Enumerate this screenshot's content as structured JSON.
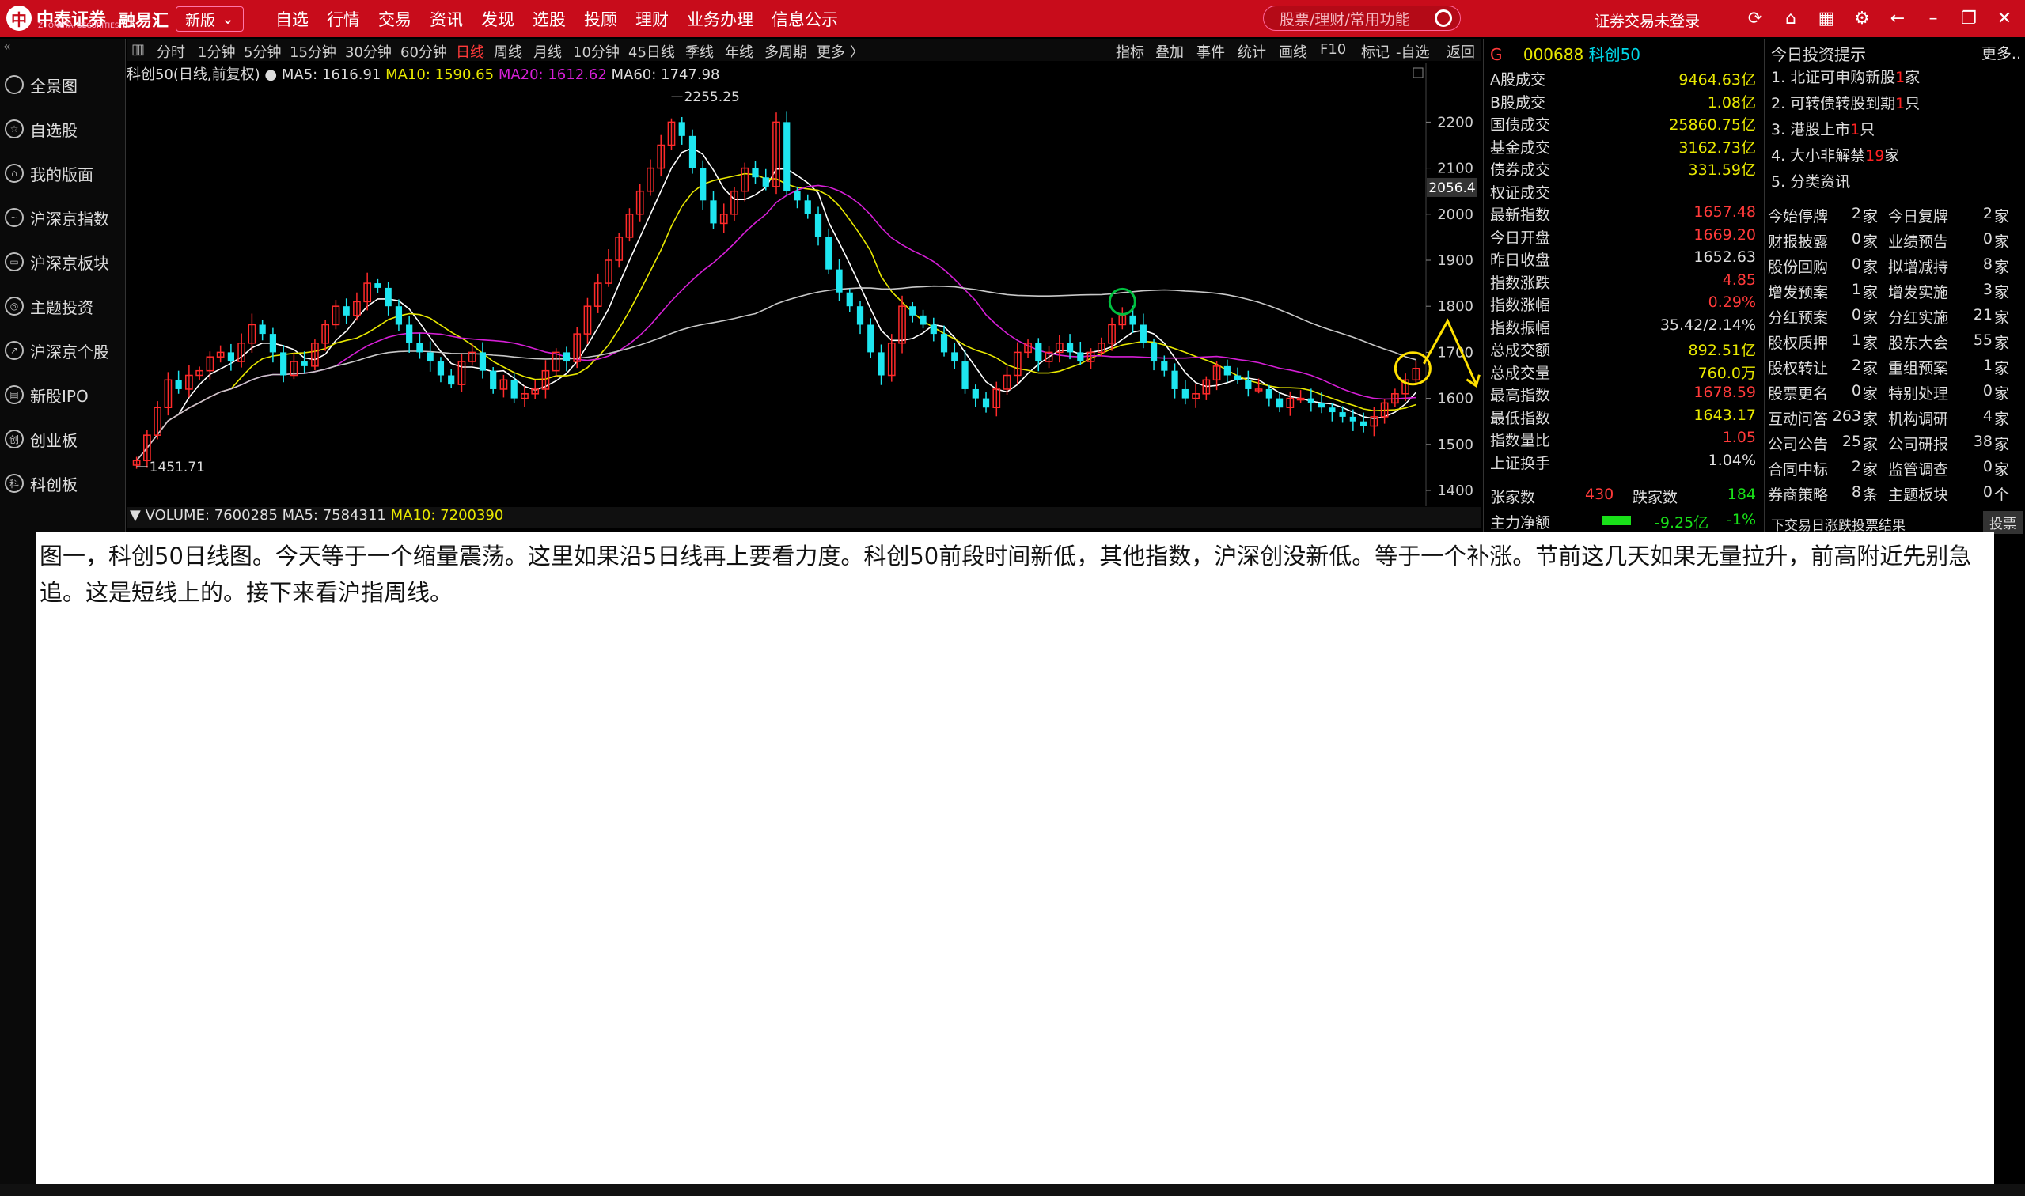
{
  "titlebar": {
    "logo_text": "中泰证券",
    "logo_en": "ZHONGTAI SECURITIES",
    "brand2": "融易汇",
    "version_select": "新版",
    "menu": [
      "自选",
      "行情",
      "交易",
      "资讯",
      "发现",
      "选股",
      "投顾",
      "理财",
      "业务办理",
      "信息公示"
    ],
    "search_placeholder": "股票/理财/常用功能",
    "login_status": "证券交易未登录"
  },
  "toolbar": {
    "periods": [
      "分时",
      "1分钟",
      "5分钟",
      "15分钟",
      "30分钟",
      "60分钟",
      "日线",
      "周线",
      "月线",
      "10分钟",
      "45日线",
      "季线",
      "年线",
      "多周期",
      "更多 〉"
    ],
    "active_period": "日线",
    "tools": [
      "指标",
      "叠加",
      "事件",
      "统计",
      "画线",
      "F10",
      "标记",
      "-自选",
      "返回"
    ]
  },
  "leftnav": {
    "items": [
      "全景图",
      "自选股",
      "我的版面",
      "沪深京指数",
      "沪深京板块",
      "主题投资",
      "沪深京个股",
      "新股IPO",
      "创业板",
      "科创板"
    ]
  },
  "chart": {
    "legend": {
      "name": "科创50(日线,前复权)",
      "ma5": "MA5: 1616.91",
      "ma10": "MA10: 1590.65",
      "ma20": "MA20: 1612.62",
      "ma60": "MA60: 1747.98"
    },
    "price_labels": [
      "2200",
      "2100",
      "2000",
      "1900",
      "1800",
      "1700",
      "1600",
      "1500",
      "1400"
    ],
    "current_price_tag": "2056.4",
    "high_mark": "2255.25",
    "low_mark": "1451.71",
    "volume_line": {
      "volume": "VOLUME: 7600285",
      "ma5": "MA5: 7584311",
      "ma10": "MA10: 7200390"
    },
    "colors": {
      "up": "#ff2a2a",
      "down": "#1ee6f0",
      "ma5": "#ffffff",
      "ma10": "#e8e800",
      "ma20": "#d61fd6",
      "ma60": "#c8c8c8",
      "annotation": "#ffe000",
      "circle_green": "#00c040"
    }
  },
  "chart_data": {
    "type": "candlestick",
    "title": "科创50(日线,前复权)",
    "ylim": [
      1400,
      2290
    ],
    "candles_close": [
      1465,
      1520,
      1580,
      1640,
      1620,
      1650,
      1660,
      1690,
      1700,
      1680,
      1720,
      1760,
      1740,
      1700,
      1650,
      1680,
      1670,
      1720,
      1760,
      1800,
      1780,
      1810,
      1850,
      1840,
      1800,
      1760,
      1720,
      1700,
      1680,
      1650,
      1630,
      1680,
      1700,
      1660,
      1620,
      1640,
      1600,
      1610,
      1620,
      1660,
      1700,
      1680,
      1740,
      1800,
      1850,
      1900,
      1950,
      2000,
      2050,
      2100,
      2150,
      2200,
      2170,
      2100,
      2030,
      1980,
      2000,
      2050,
      2100,
      2080,
      2060,
      2200,
      2050,
      2030,
      2000,
      1950,
      1880,
      1830,
      1800,
      1760,
      1700,
      1650,
      1720,
      1800,
      1780,
      1760,
      1740,
      1700,
      1680,
      1620,
      1600,
      1580,
      1620,
      1650,
      1700,
      1720,
      1680,
      1700,
      1720,
      1700,
      1680,
      1700,
      1720,
      1760,
      1780,
      1760,
      1720,
      1680,
      1660,
      1620,
      1600,
      1610,
      1640,
      1670,
      1650,
      1640,
      1620,
      1620,
      1600,
      1580,
      1600,
      1600,
      1590,
      1580,
      1570,
      1560,
      1550,
      1540,
      1560,
      1590,
      1610,
      1640,
      1665
    ],
    "annotations": [
      "high 2255.25",
      "low 1451.71",
      "green circle near recent high",
      "yellow circle on latest candle with arrow"
    ]
  },
  "panel1": {
    "code": "000688",
    "name": "科创50",
    "flag": "G",
    "rows": [
      {
        "k": "A股成交",
        "v": "9464.63亿",
        "c": "yel"
      },
      {
        "k": "B股成交",
        "v": "1.08亿",
        "c": "yel"
      },
      {
        "k": "国债成交",
        "v": "25860.75亿",
        "c": "yel"
      },
      {
        "k": "基金成交",
        "v": "3162.73亿",
        "c": "yel"
      },
      {
        "k": "债券成交",
        "v": "331.59亿",
        "c": "yel"
      },
      {
        "k": "权证成交",
        "v": "",
        "c": "yel"
      },
      {
        "k": "最新指数",
        "v": "1657.48",
        "c": "red"
      },
      {
        "k": "今日开盘",
        "v": "1669.20",
        "c": "red"
      },
      {
        "k": "昨日收盘",
        "v": "1652.63",
        "c": "white"
      },
      {
        "k": "指数涨跌",
        "v": "4.85",
        "c": "red"
      },
      {
        "k": "指数涨幅",
        "v": "0.29%",
        "c": "red"
      },
      {
        "k": "指数振幅",
        "v": "35.42/2.14%",
        "c": "white"
      },
      {
        "k": "总成交额",
        "v": "892.51亿",
        "c": "yel"
      },
      {
        "k": "总成交量",
        "v": "760.0万",
        "c": "yel"
      },
      {
        "k": "最高指数",
        "v": "1678.59",
        "c": "red"
      },
      {
        "k": "最低指数",
        "v": "1643.17",
        "c": "yel"
      },
      {
        "k": "指数量比",
        "v": "1.05",
        "c": "red"
      },
      {
        "k": "上证换手",
        "v": "1.04%",
        "c": "white"
      }
    ],
    "updown": {
      "up_label": "张家数",
      "up": "430",
      "down_label": "跌家数",
      "down": "184"
    },
    "main_flow": {
      "k": "主力净额",
      "v": "-9.25亿",
      "pct": "-1%"
    }
  },
  "panel2": {
    "title": "今日投资提示",
    "more": "更多..",
    "tips": [
      {
        "t": "1. 北证可申购新股",
        "n": "1",
        "u": "家"
      },
      {
        "t": "2. 可转债转股到期",
        "n": "1",
        "u": "只"
      },
      {
        "t": "3. 港股上市",
        "n": "1",
        "u": "只"
      },
      {
        "t": "4. 大小非解禁",
        "n": "19",
        "u": "家"
      },
      {
        "t": "5. 分类资讯",
        "n": "",
        "u": ""
      }
    ],
    "grid": [
      [
        "今始停牌",
        "2",
        "家",
        "今日复牌",
        "2",
        "家"
      ],
      [
        "财报披露",
        "0",
        "家",
        "业绩预告",
        "0",
        "家"
      ],
      [
        "股份回购",
        "0",
        "家",
        "拟增减持",
        "8",
        "家"
      ],
      [
        "增发预案",
        "1",
        "家",
        "增发实施",
        "3",
        "家"
      ],
      [
        "分红预案",
        "0",
        "家",
        "分红实施",
        "21",
        "家"
      ],
      [
        "股权质押",
        "1",
        "家",
        "股东大会",
        "55",
        "家"
      ],
      [
        "股权转让",
        "2",
        "家",
        "重组预案",
        "1",
        "家"
      ],
      [
        "股票更名",
        "0",
        "家",
        "特别处理",
        "0",
        "家"
      ],
      [
        "互动问答",
        "263",
        "家",
        "机构调研",
        "4",
        "家"
      ],
      [
        "公司公告",
        "25",
        "家",
        "公司研报",
        "38",
        "家"
      ],
      [
        "合同中标",
        "2",
        "家",
        "监管调查",
        "0",
        "家"
      ],
      [
        "券商策略",
        "8",
        "条",
        "主题板块",
        "0",
        "个"
      ]
    ],
    "footer": "下交易日涨跌投票结果",
    "vote_button": "投票"
  },
  "overlay": {
    "text": "图一，科创50日线图。今天等于一个缩量震荡。这里如果沿5日线再上要看力度。科创50前段时间新低，其他指数，沪深创没新低。等于一个补涨。节前这几天如果无量拉升，前高附近先别急追。这是短线上的。接下来看沪指周线。"
  }
}
